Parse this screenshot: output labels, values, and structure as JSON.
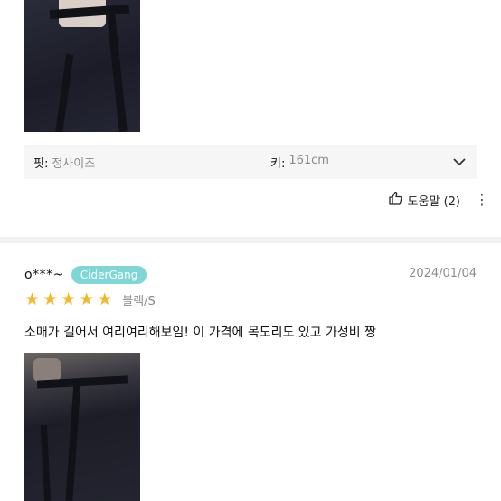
{
  "first_review": {
    "spec": {
      "fit_key": "핏:",
      "fit_value": "정사이즈",
      "height_key": "키:",
      "height_value": "161cm"
    },
    "helpful_label": "도움말",
    "helpful_count": "(2)"
  },
  "second_review": {
    "username": "o***~",
    "badge": "CiderGang",
    "date": "2024/01/04",
    "rating": 5,
    "option": "블랙/S",
    "text": "소매가 길어서 여리여리해보임! 이 가격에 목도리도 있고 가성비 짱"
  },
  "colors": {
    "star": "#f4b82a",
    "badge_bg": "#7fd6d6",
    "spec_bg": "#f6f6f6"
  },
  "icons": [
    "chevron-down-icon",
    "thumbs-up-icon",
    "more-dots-icon",
    "star-icon"
  ]
}
